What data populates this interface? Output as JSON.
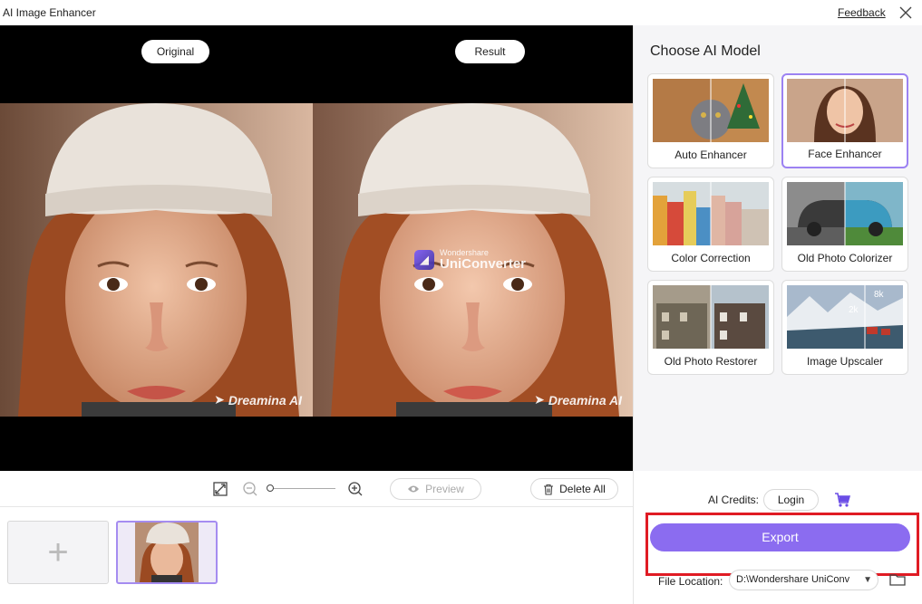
{
  "titlebar": {
    "app_title": "AI Image Enhancer",
    "feedback": "Feedback"
  },
  "preview": {
    "original_label": "Original",
    "result_label": "Result",
    "watermark_left": "Dreamina AI",
    "watermark_right": "Dreamina AI",
    "uniconverter_small": "Wondershare",
    "uniconverter_big": "UniConverter"
  },
  "toolbar": {
    "preview_label": "Preview",
    "delete_all_label": "Delete All",
    "icons": [
      "fit-screen-icon",
      "zoom-out-icon",
      "zoom-in-icon",
      "eye-icon",
      "trash-icon"
    ]
  },
  "thumbnails": {
    "add_icon": "plus-icon"
  },
  "panel": {
    "title": "Choose AI Model",
    "models": [
      {
        "label": "Auto Enhancer",
        "selected": false
      },
      {
        "label": "Face Enhancer",
        "selected": true
      },
      {
        "label": "Color Correction",
        "selected": false
      },
      {
        "label": "Old Photo Colorizer",
        "selected": false
      },
      {
        "label": "Old Photo Restorer",
        "selected": false
      },
      {
        "label": "Image Upscaler",
        "selected": false
      }
    ],
    "upscaler_marks": [
      "2k",
      "8k"
    ]
  },
  "bottom": {
    "credits_label": "AI Credits:",
    "login_label": "Login",
    "export_label": "Export",
    "file_location_label": "File Location:",
    "file_location_value": "D:\\Wondershare UniConv"
  },
  "colors": {
    "accent": "#8b6cf0",
    "selected_border": "#9c82f2",
    "highlight": "#e01b24"
  }
}
